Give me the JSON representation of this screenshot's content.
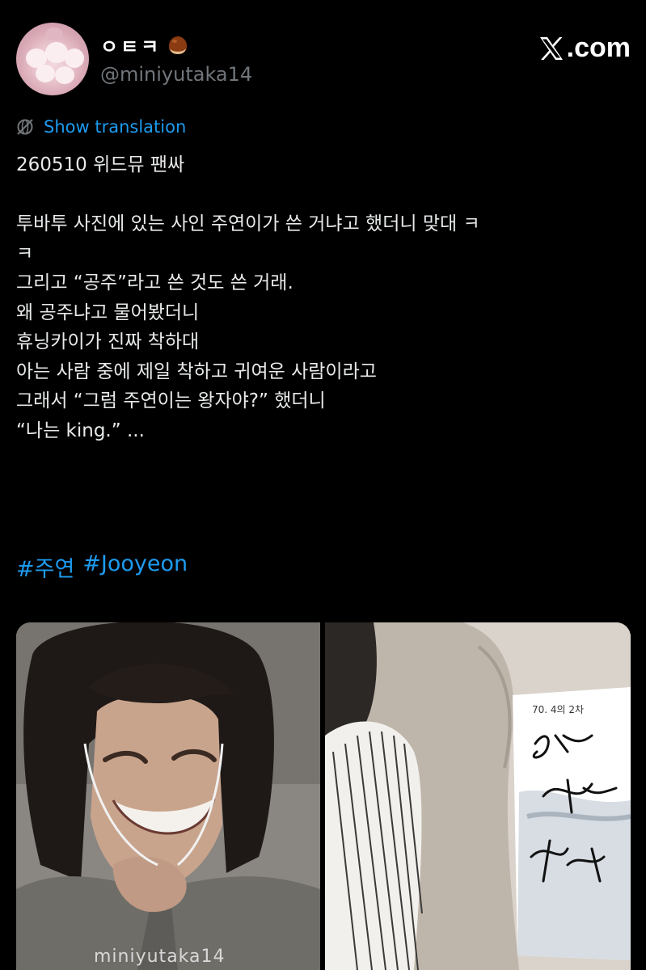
{
  "user": {
    "display_name": "ㅇㅌㅋ",
    "handle": "@miniyutaka14"
  },
  "site_label": ".com",
  "translate_label": "Show translation",
  "tweet_lines": [
    "260510 위드뮤 팬싸",
    "",
    "투바투 사진에 있는 사인 주연이가 쓴 거냐고 했더니 맞대 ㅋ",
    "ㅋ",
    "그리고 “공주”라고 쓴 것도 쓴 거래.",
    "왜 공주냐고 물어봤더니",
    "휴닝카이가 진짜 착하대",
    "아는 사람 중에 제일 착하고 귀여운 사람이라고",
    "그래서 “그럼 주연이는 왕자야?” 했더니",
    "“나는 king.” ..."
  ],
  "hashtags": [
    "#주연",
    "#Jooyeon"
  ],
  "media": {
    "watermark": "miniyutaka14",
    "signature_card_text": "70. 4의 2차"
  },
  "colors": {
    "background": "#000000",
    "text": "#e7e9ea",
    "link": "#1d9bf0",
    "secondary": "#71767b"
  },
  "icons": [
    "chestnut-emoji-icon",
    "x-logo-icon",
    "translate-globe-icon"
  ]
}
